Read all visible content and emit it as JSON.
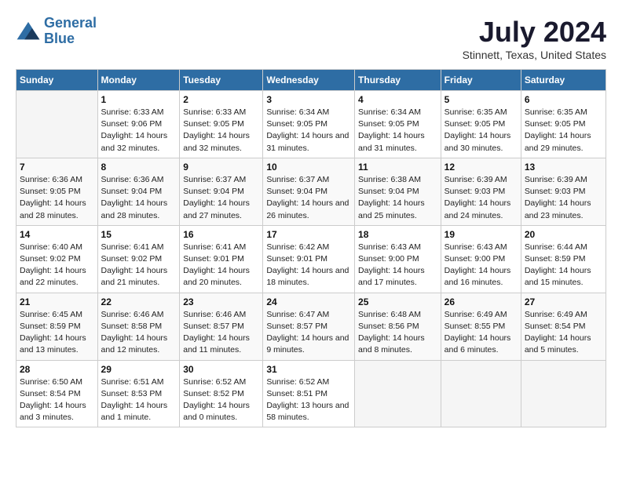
{
  "logo": {
    "line1": "General",
    "line2": "Blue"
  },
  "title": "July 2024",
  "subtitle": "Stinnett, Texas, United States",
  "days": [
    "Sunday",
    "Monday",
    "Tuesday",
    "Wednesday",
    "Thursday",
    "Friday",
    "Saturday"
  ],
  "weeks": [
    [
      {
        "date": "",
        "sunrise": "",
        "sunset": "",
        "daylight": ""
      },
      {
        "date": "1",
        "sunrise": "Sunrise: 6:33 AM",
        "sunset": "Sunset: 9:06 PM",
        "daylight": "Daylight: 14 hours and 32 minutes."
      },
      {
        "date": "2",
        "sunrise": "Sunrise: 6:33 AM",
        "sunset": "Sunset: 9:05 PM",
        "daylight": "Daylight: 14 hours and 32 minutes."
      },
      {
        "date": "3",
        "sunrise": "Sunrise: 6:34 AM",
        "sunset": "Sunset: 9:05 PM",
        "daylight": "Daylight: 14 hours and 31 minutes."
      },
      {
        "date": "4",
        "sunrise": "Sunrise: 6:34 AM",
        "sunset": "Sunset: 9:05 PM",
        "daylight": "Daylight: 14 hours and 31 minutes."
      },
      {
        "date": "5",
        "sunrise": "Sunrise: 6:35 AM",
        "sunset": "Sunset: 9:05 PM",
        "daylight": "Daylight: 14 hours and 30 minutes."
      },
      {
        "date": "6",
        "sunrise": "Sunrise: 6:35 AM",
        "sunset": "Sunset: 9:05 PM",
        "daylight": "Daylight: 14 hours and 29 minutes."
      }
    ],
    [
      {
        "date": "7",
        "sunrise": "Sunrise: 6:36 AM",
        "sunset": "Sunset: 9:05 PM",
        "daylight": "Daylight: 14 hours and 28 minutes."
      },
      {
        "date": "8",
        "sunrise": "Sunrise: 6:36 AM",
        "sunset": "Sunset: 9:04 PM",
        "daylight": "Daylight: 14 hours and 28 minutes."
      },
      {
        "date": "9",
        "sunrise": "Sunrise: 6:37 AM",
        "sunset": "Sunset: 9:04 PM",
        "daylight": "Daylight: 14 hours and 27 minutes."
      },
      {
        "date": "10",
        "sunrise": "Sunrise: 6:37 AM",
        "sunset": "Sunset: 9:04 PM",
        "daylight": "Daylight: 14 hours and 26 minutes."
      },
      {
        "date": "11",
        "sunrise": "Sunrise: 6:38 AM",
        "sunset": "Sunset: 9:04 PM",
        "daylight": "Daylight: 14 hours and 25 minutes."
      },
      {
        "date": "12",
        "sunrise": "Sunrise: 6:39 AM",
        "sunset": "Sunset: 9:03 PM",
        "daylight": "Daylight: 14 hours and 24 minutes."
      },
      {
        "date": "13",
        "sunrise": "Sunrise: 6:39 AM",
        "sunset": "Sunset: 9:03 PM",
        "daylight": "Daylight: 14 hours and 23 minutes."
      }
    ],
    [
      {
        "date": "14",
        "sunrise": "Sunrise: 6:40 AM",
        "sunset": "Sunset: 9:02 PM",
        "daylight": "Daylight: 14 hours and 22 minutes."
      },
      {
        "date": "15",
        "sunrise": "Sunrise: 6:41 AM",
        "sunset": "Sunset: 9:02 PM",
        "daylight": "Daylight: 14 hours and 21 minutes."
      },
      {
        "date": "16",
        "sunrise": "Sunrise: 6:41 AM",
        "sunset": "Sunset: 9:01 PM",
        "daylight": "Daylight: 14 hours and 20 minutes."
      },
      {
        "date": "17",
        "sunrise": "Sunrise: 6:42 AM",
        "sunset": "Sunset: 9:01 PM",
        "daylight": "Daylight: 14 hours and 18 minutes."
      },
      {
        "date": "18",
        "sunrise": "Sunrise: 6:43 AM",
        "sunset": "Sunset: 9:00 PM",
        "daylight": "Daylight: 14 hours and 17 minutes."
      },
      {
        "date": "19",
        "sunrise": "Sunrise: 6:43 AM",
        "sunset": "Sunset: 9:00 PM",
        "daylight": "Daylight: 14 hours and 16 minutes."
      },
      {
        "date": "20",
        "sunrise": "Sunrise: 6:44 AM",
        "sunset": "Sunset: 8:59 PM",
        "daylight": "Daylight: 14 hours and 15 minutes."
      }
    ],
    [
      {
        "date": "21",
        "sunrise": "Sunrise: 6:45 AM",
        "sunset": "Sunset: 8:59 PM",
        "daylight": "Daylight: 14 hours and 13 minutes."
      },
      {
        "date": "22",
        "sunrise": "Sunrise: 6:46 AM",
        "sunset": "Sunset: 8:58 PM",
        "daylight": "Daylight: 14 hours and 12 minutes."
      },
      {
        "date": "23",
        "sunrise": "Sunrise: 6:46 AM",
        "sunset": "Sunset: 8:57 PM",
        "daylight": "Daylight: 14 hours and 11 minutes."
      },
      {
        "date": "24",
        "sunrise": "Sunrise: 6:47 AM",
        "sunset": "Sunset: 8:57 PM",
        "daylight": "Daylight: 14 hours and 9 minutes."
      },
      {
        "date": "25",
        "sunrise": "Sunrise: 6:48 AM",
        "sunset": "Sunset: 8:56 PM",
        "daylight": "Daylight: 14 hours and 8 minutes."
      },
      {
        "date": "26",
        "sunrise": "Sunrise: 6:49 AM",
        "sunset": "Sunset: 8:55 PM",
        "daylight": "Daylight: 14 hours and 6 minutes."
      },
      {
        "date": "27",
        "sunrise": "Sunrise: 6:49 AM",
        "sunset": "Sunset: 8:54 PM",
        "daylight": "Daylight: 14 hours and 5 minutes."
      }
    ],
    [
      {
        "date": "28",
        "sunrise": "Sunrise: 6:50 AM",
        "sunset": "Sunset: 8:54 PM",
        "daylight": "Daylight: 14 hours and 3 minutes."
      },
      {
        "date": "29",
        "sunrise": "Sunrise: 6:51 AM",
        "sunset": "Sunset: 8:53 PM",
        "daylight": "Daylight: 14 hours and 1 minute."
      },
      {
        "date": "30",
        "sunrise": "Sunrise: 6:52 AM",
        "sunset": "Sunset: 8:52 PM",
        "daylight": "Daylight: 14 hours and 0 minutes."
      },
      {
        "date": "31",
        "sunrise": "Sunrise: 6:52 AM",
        "sunset": "Sunset: 8:51 PM",
        "daylight": "Daylight: 13 hours and 58 minutes."
      },
      {
        "date": "",
        "sunrise": "",
        "sunset": "",
        "daylight": ""
      },
      {
        "date": "",
        "sunrise": "",
        "sunset": "",
        "daylight": ""
      },
      {
        "date": "",
        "sunrise": "",
        "sunset": "",
        "daylight": ""
      }
    ]
  ]
}
